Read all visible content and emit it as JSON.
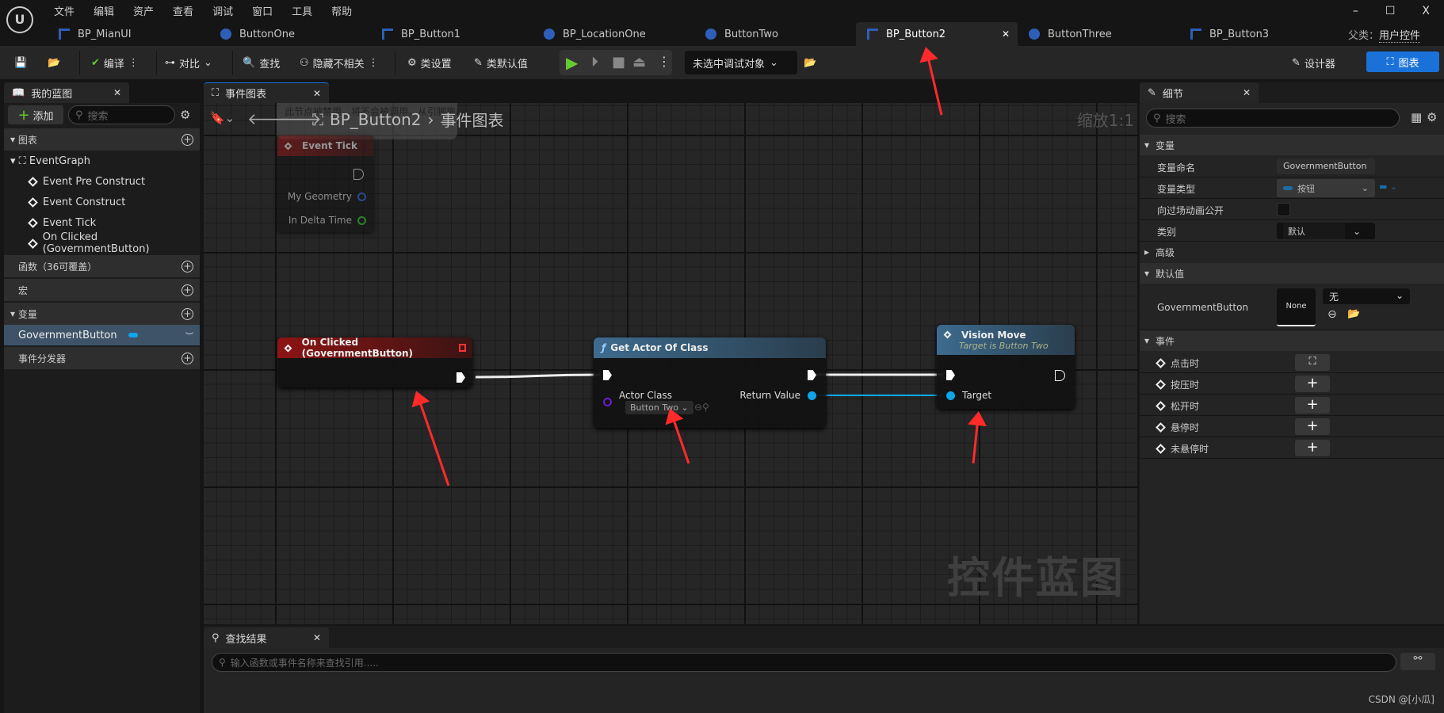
{
  "menu": [
    "文件",
    "编辑",
    "资产",
    "查看",
    "调试",
    "窗口",
    "工具",
    "帮助"
  ],
  "window_controls": {
    "minimize": "–",
    "maximize": "☐",
    "close": "X"
  },
  "doc_tabs": [
    {
      "label": "BP_MianUI",
      "type": "blueprint"
    },
    {
      "label": "ButtonOne",
      "type": "actor"
    },
    {
      "label": "BP_Button1",
      "type": "blueprint"
    },
    {
      "label": "BP_LocationOne",
      "type": "actor"
    },
    {
      "label": "ButtonTwo",
      "type": "actor"
    },
    {
      "label": "BP_Button2",
      "type": "blueprint",
      "active": true
    },
    {
      "label": "ButtonThree",
      "type": "actor"
    },
    {
      "label": "BP_Button3",
      "type": "blueprint"
    }
  ],
  "parent_class": {
    "label": "父类：",
    "value": "用户控件"
  },
  "toolbar": {
    "compile": "编译",
    "diff": "对比",
    "find": "查找",
    "hide_unrelated": "隐藏不相关",
    "class_settings": "类设置",
    "class_defaults": "类默认值",
    "debug_target": "未选中调试对象",
    "designer": "设计器",
    "graph": "图表"
  },
  "my_blueprint": {
    "tab": "我的蓝图",
    "add": "添加",
    "search_placeholder": "搜索",
    "graphs_header": "图表",
    "event_graph": "EventGraph",
    "events": [
      "Event Pre Construct",
      "Event Construct",
      "Event Tick",
      "On Clicked (GovernmentButton)"
    ],
    "functions": "函数（36可覆盖）",
    "macros": "宏",
    "variables": "变量",
    "variable_items": [
      "GovernmentButton"
    ],
    "dispatchers": "事件分发器"
  },
  "graph": {
    "tab": "事件图表",
    "breadcrumb": [
      "BP_Button2",
      "事件图表"
    ],
    "zoom": "缩放1:1",
    "watermark": "控件蓝图",
    "disabled_note": "此节点被禁用，将不会被调用。从引脚拖出引线来启用功能。",
    "nodes": {
      "event_tick": {
        "title": "Event Tick",
        "pins": [
          "My Geometry",
          "In Delta Time"
        ]
      },
      "on_clicked": {
        "title": "On Clicked (GovernmentButton)"
      },
      "get_actor": {
        "title": "Get Actor Of Class",
        "in_pin": "Actor Class",
        "class_value": "Button Two",
        "out_pin": "Return Value"
      },
      "vision_move": {
        "title": "Vision Move",
        "subtitle": "Target is Button Two",
        "in_pin": "Target"
      }
    }
  },
  "details": {
    "tab": "细节",
    "search_placeholder": "搜索",
    "variable_section": "变量",
    "rows": [
      {
        "label": "变量命名",
        "value": "GovernmentButton"
      },
      {
        "label": "变量类型",
        "value": "按钮"
      },
      {
        "label": "向过场动画公开",
        "value": ""
      },
      {
        "label": "类别",
        "value": "默认"
      }
    ],
    "advanced": "高级",
    "default_section": "默认值",
    "default_label": "GovernmentButton",
    "default_thumb": "None",
    "default_value": "无",
    "events_section": "事件",
    "events": [
      "点击时",
      "按压时",
      "松开时",
      "悬停时",
      "未悬停时"
    ]
  },
  "find_results": {
    "tab": "查找结果",
    "placeholder": "输入函数或事件名称来查找引用....."
  },
  "watermark_credit": "CSDN @[小瓜]",
  "colors": {
    "accent": "#1a72d8",
    "event_node": "#8d1414",
    "function_node": "#3d6b8e",
    "object_pin": "#0ea5e9",
    "annotation_arrow": "#ff2a2a"
  }
}
